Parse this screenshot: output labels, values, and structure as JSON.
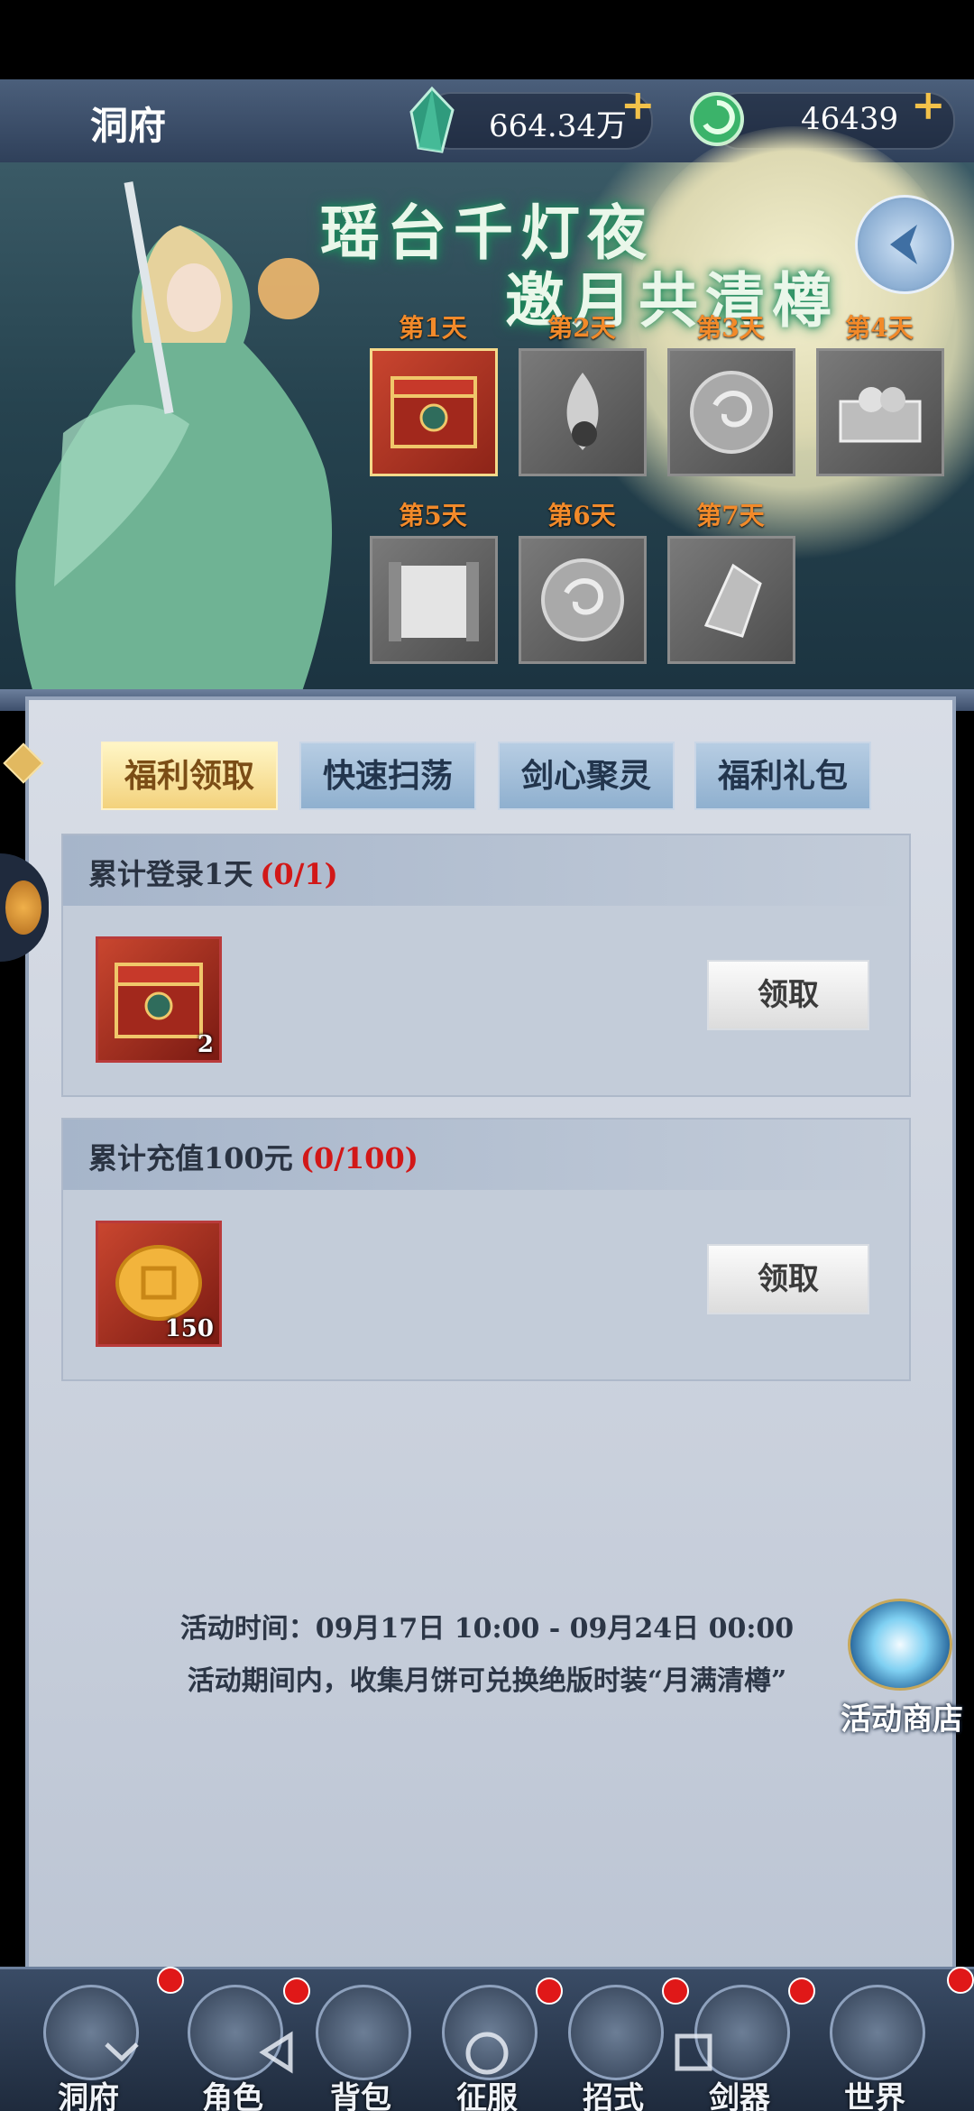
{
  "topbar": {
    "title": "洞府",
    "currency1": {
      "icon": "jade-crystal-icon",
      "value": "664.34万"
    },
    "currency2": {
      "icon": "jade-coin-icon",
      "value": "46439"
    },
    "plus": "+"
  },
  "banner": {
    "title_line1": "瑶台千灯夜",
    "title_line2": "邀月共清樽",
    "days": [
      {
        "label": "第1天",
        "item": "red-treasure-chest-icon",
        "active": true
      },
      {
        "label": "第2天",
        "item": "spirit-flame-icon",
        "active": false
      },
      {
        "label": "第3天",
        "item": "jade-token-icon",
        "active": false
      },
      {
        "label": "第4天",
        "item": "silver-chest-icon",
        "active": false
      },
      {
        "label": "第5天",
        "item": "scroll-icon",
        "active": false
      },
      {
        "label": "第6天",
        "item": "jade-token-icon",
        "active": false
      },
      {
        "label": "第7天",
        "item": "crystal-shard-icon",
        "active": false
      }
    ]
  },
  "tabs": [
    {
      "label": "福利领取",
      "active": true
    },
    {
      "label": "快速扫荡",
      "active": false
    },
    {
      "label": "剑心聚灵",
      "active": false
    },
    {
      "label": "福利礼包",
      "active": false
    }
  ],
  "tasks": [
    {
      "title": "累计登录1天",
      "progress": "(0/1)",
      "item": "red-treasure-chest-icon",
      "count": "2",
      "button": "领取"
    },
    {
      "title": "累计充值100元",
      "progress": "(0/100)",
      "item": "mooncake-icon",
      "count": "150",
      "button": "领取"
    }
  ],
  "info": {
    "time": "活动时间：09月17日 10:00 - 09月24日 00:00",
    "desc": "活动期间内，收集月饼可兑换绝版时装“月满清樽”"
  },
  "shop": {
    "label": "活动商店",
    "icon": "activity-shop-icon"
  },
  "nav": [
    {
      "label": "洞府",
      "icon": "cave-house-icon",
      "badge": true
    },
    {
      "label": "角色",
      "icon": "character-icon",
      "badge": true
    },
    {
      "label": "背包",
      "icon": "bag-icon",
      "badge": false
    },
    {
      "label": "征服",
      "icon": "crossed-swords-icon",
      "badge": true
    },
    {
      "label": "招式",
      "icon": "skill-book-icon",
      "badge": true
    },
    {
      "label": "剑器",
      "icon": "sword-icon",
      "badge": true
    },
    {
      "label": "世界",
      "icon": "world-map-icon",
      "badge": true
    }
  ],
  "system_nav": [
    "chevron-down-icon",
    "back-triangle-icon",
    "home-circle-icon",
    "recents-square-icon"
  ],
  "colors": {
    "accent": "#f3c24a",
    "progress_red": "#d21818",
    "day_label": "#f28a2a"
  }
}
